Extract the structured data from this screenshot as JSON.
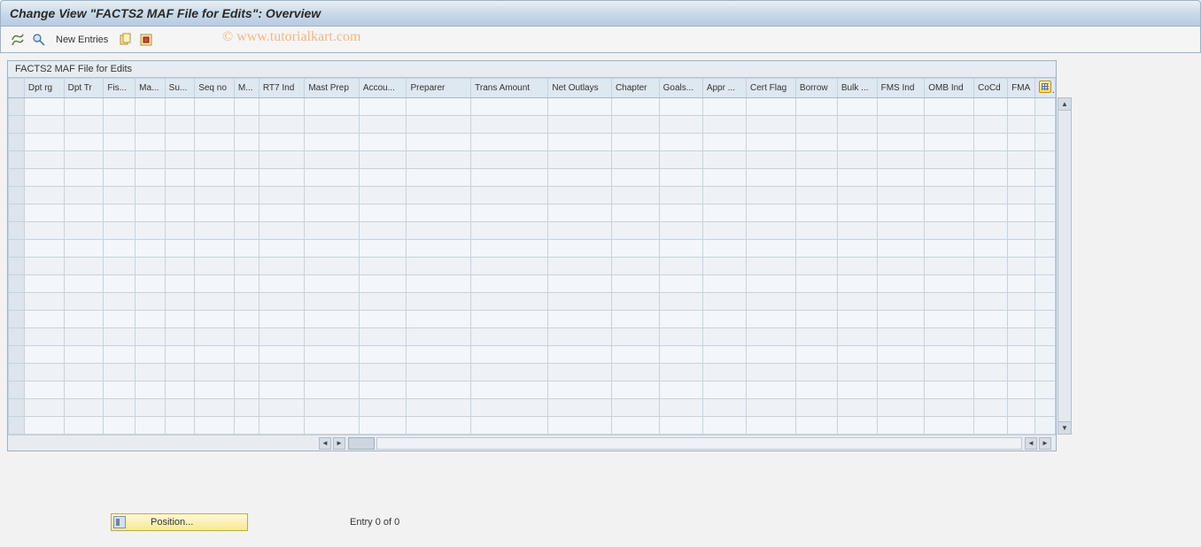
{
  "title": "Change View \"FACTS2  MAF File for Edits\": Overview",
  "toolbar": {
    "new_entries_label": "New Entries"
  },
  "watermark": "©  www.tutorialkart.com",
  "panel": {
    "header": "FACTS2  MAF File for Edits"
  },
  "columns": [
    {
      "label": "Dpt rg",
      "w": 40
    },
    {
      "label": "Dpt Tr",
      "w": 40
    },
    {
      "label": "Fis...",
      "w": 32
    },
    {
      "label": "Ma...",
      "w": 30
    },
    {
      "label": "Su...",
      "w": 30
    },
    {
      "label": "Seq no",
      "w": 40
    },
    {
      "label": "M...",
      "w": 25
    },
    {
      "label": "RT7 Ind",
      "w": 46
    },
    {
      "label": "Mast Prep",
      "w": 55
    },
    {
      "label": "Accou...",
      "w": 48
    },
    {
      "label": "Preparer",
      "w": 65
    },
    {
      "label": "Trans Amount",
      "w": 78
    },
    {
      "label": "Net Outlays",
      "w": 64
    },
    {
      "label": "Chapter",
      "w": 48
    },
    {
      "label": "Goals...",
      "w": 44
    },
    {
      "label": "Appr ...",
      "w": 44
    },
    {
      "label": "Cert Flag",
      "w": 50
    },
    {
      "label": "Borrow",
      "w": 42
    },
    {
      "label": "Bulk ...",
      "w": 40
    },
    {
      "label": "FMS Ind",
      "w": 48
    },
    {
      "label": "OMB Ind",
      "w": 50
    },
    {
      "label": "CoCd",
      "w": 34
    },
    {
      "label": "FMA",
      "w": 28
    }
  ],
  "row_count": 19,
  "footer": {
    "position_label": "Position...",
    "entry_status": "Entry 0 of 0"
  }
}
